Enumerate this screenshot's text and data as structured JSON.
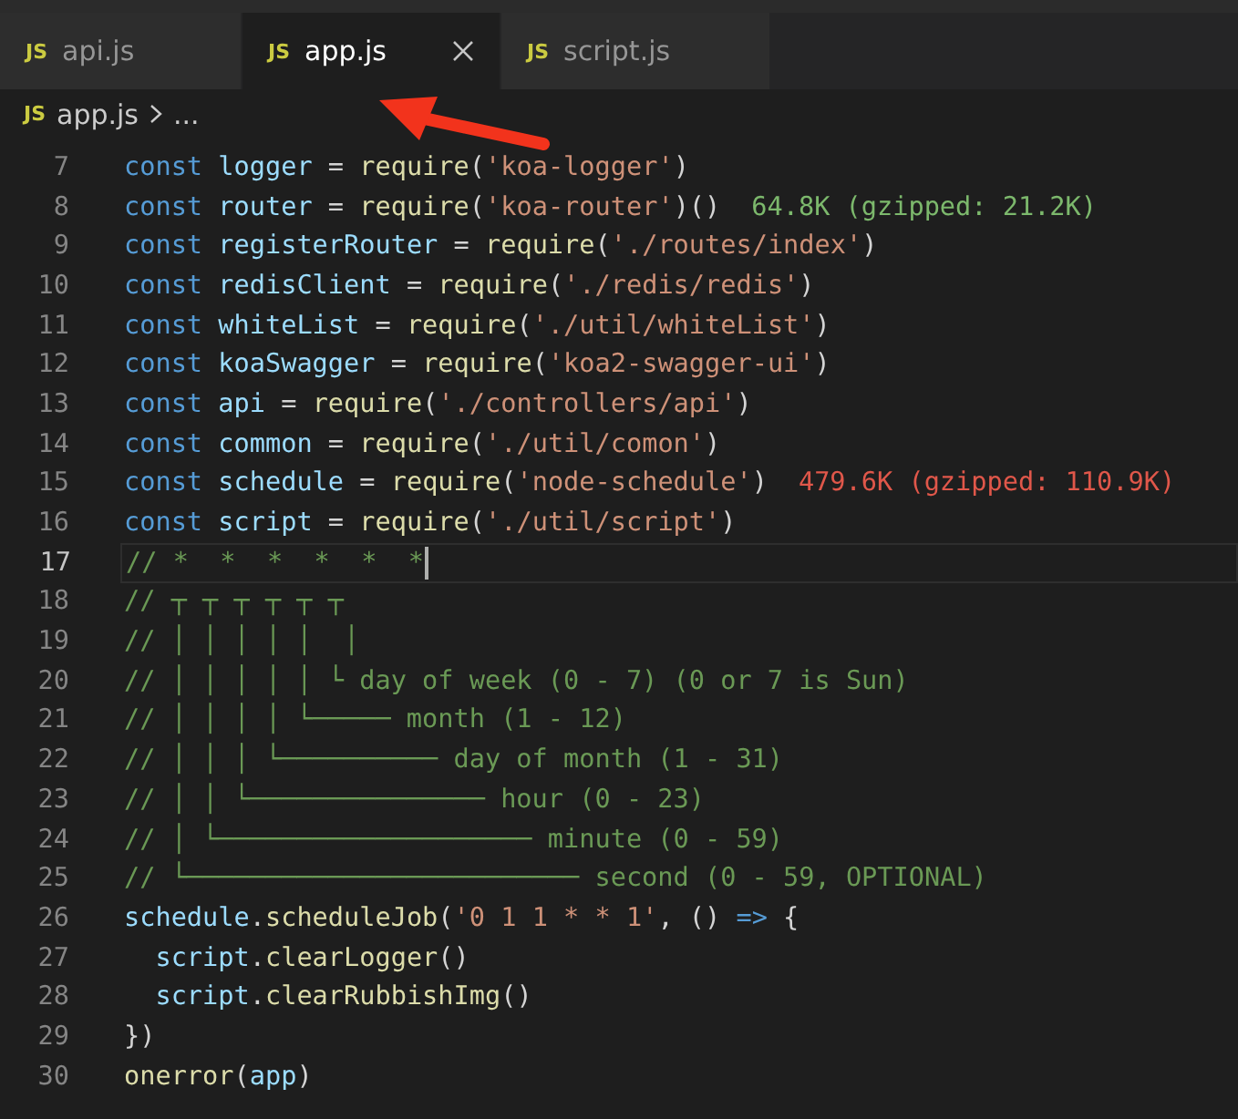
{
  "tabs": [
    {
      "badge": "JS",
      "label": "api.js",
      "selected": false
    },
    {
      "badge": "JS",
      "label": "app.js",
      "selected": true
    },
    {
      "badge": "JS",
      "label": "script.js",
      "selected": false
    }
  ],
  "breadcrumb": {
    "badge": "JS",
    "file": "app.js",
    "rest": "..."
  },
  "lines": [
    {
      "number": "7",
      "current": false,
      "tokens": [
        {
          "kind": "keyword",
          "text": "const "
        },
        {
          "kind": "variable",
          "text": "logger"
        },
        {
          "kind": "plain",
          "text": " = "
        },
        {
          "kind": "function",
          "text": "require"
        },
        {
          "kind": "plain",
          "text": "("
        },
        {
          "kind": "string",
          "text": "'koa-logger'"
        },
        {
          "kind": "plain",
          "text": ")"
        }
      ]
    },
    {
      "number": "8",
      "current": false,
      "tokens": [
        {
          "kind": "keyword",
          "text": "const "
        },
        {
          "kind": "variable",
          "text": "router"
        },
        {
          "kind": "plain",
          "text": " = "
        },
        {
          "kind": "function",
          "text": "require"
        },
        {
          "kind": "plain",
          "text": "("
        },
        {
          "kind": "string",
          "text": "'koa-router'"
        },
        {
          "kind": "plain",
          "text": ")()"
        }
      ],
      "hint": {
        "text": "64.8K (gzipped: 21.2K)",
        "color": "#7cb86c"
      }
    },
    {
      "number": "9",
      "current": false,
      "tokens": [
        {
          "kind": "keyword",
          "text": "const "
        },
        {
          "kind": "variable",
          "text": "registerRouter"
        },
        {
          "kind": "plain",
          "text": " = "
        },
        {
          "kind": "function",
          "text": "require"
        },
        {
          "kind": "plain",
          "text": "("
        },
        {
          "kind": "string",
          "text": "'./routes/index'"
        },
        {
          "kind": "plain",
          "text": ")"
        }
      ]
    },
    {
      "number": "10",
      "current": false,
      "tokens": [
        {
          "kind": "keyword",
          "text": "const "
        },
        {
          "kind": "variable",
          "text": "redisClient"
        },
        {
          "kind": "plain",
          "text": " = "
        },
        {
          "kind": "function",
          "text": "require"
        },
        {
          "kind": "plain",
          "text": "("
        },
        {
          "kind": "string",
          "text": "'./redis/redis'"
        },
        {
          "kind": "plain",
          "text": ")"
        }
      ]
    },
    {
      "number": "11",
      "current": false,
      "tokens": [
        {
          "kind": "keyword",
          "text": "const "
        },
        {
          "kind": "variable",
          "text": "whiteList"
        },
        {
          "kind": "plain",
          "text": " = "
        },
        {
          "kind": "function",
          "text": "require"
        },
        {
          "kind": "plain",
          "text": "("
        },
        {
          "kind": "string",
          "text": "'./util/whiteList'"
        },
        {
          "kind": "plain",
          "text": ")"
        }
      ]
    },
    {
      "number": "12",
      "current": false,
      "tokens": [
        {
          "kind": "keyword",
          "text": "const "
        },
        {
          "kind": "variable",
          "text": "koaSwagger"
        },
        {
          "kind": "plain",
          "text": " = "
        },
        {
          "kind": "function",
          "text": "require"
        },
        {
          "kind": "plain",
          "text": "("
        },
        {
          "kind": "string",
          "text": "'koa2-swagger-ui'"
        },
        {
          "kind": "plain",
          "text": ")"
        }
      ]
    },
    {
      "number": "13",
      "current": false,
      "tokens": [
        {
          "kind": "keyword",
          "text": "const "
        },
        {
          "kind": "variable",
          "text": "api"
        },
        {
          "kind": "plain",
          "text": " = "
        },
        {
          "kind": "function",
          "text": "require"
        },
        {
          "kind": "plain",
          "text": "("
        },
        {
          "kind": "string",
          "text": "'./controllers/api'"
        },
        {
          "kind": "plain",
          "text": ")"
        }
      ]
    },
    {
      "number": "14",
      "current": false,
      "tokens": [
        {
          "kind": "keyword",
          "text": "const "
        },
        {
          "kind": "variable",
          "text": "common"
        },
        {
          "kind": "plain",
          "text": " = "
        },
        {
          "kind": "function",
          "text": "require"
        },
        {
          "kind": "plain",
          "text": "("
        },
        {
          "kind": "string",
          "text": "'./util/comon'"
        },
        {
          "kind": "plain",
          "text": ")"
        }
      ]
    },
    {
      "number": "15",
      "current": false,
      "tokens": [
        {
          "kind": "keyword",
          "text": "const "
        },
        {
          "kind": "variable",
          "text": "schedule"
        },
        {
          "kind": "plain",
          "text": " = "
        },
        {
          "kind": "function",
          "text": "require"
        },
        {
          "kind": "plain",
          "text": "("
        },
        {
          "kind": "string",
          "text": "'node-schedule'"
        },
        {
          "kind": "plain",
          "text": ")"
        }
      ],
      "hint": {
        "text": "479.6K (gzipped: 110.9K)",
        "color": "#e0574a"
      }
    },
    {
      "number": "16",
      "current": false,
      "tokens": [
        {
          "kind": "keyword",
          "text": "const "
        },
        {
          "kind": "variable",
          "text": "script"
        },
        {
          "kind": "plain",
          "text": " = "
        },
        {
          "kind": "function",
          "text": "require"
        },
        {
          "kind": "plain",
          "text": "("
        },
        {
          "kind": "string",
          "text": "'./util/script'"
        },
        {
          "kind": "plain",
          "text": ")"
        }
      ]
    },
    {
      "number": "17",
      "current": true,
      "tokens": [
        {
          "kind": "comment",
          "text": "// *  *  *  *  *  *"
        }
      ]
    },
    {
      "number": "18",
      "current": false,
      "tokens": [
        {
          "kind": "comment",
          "text": "// ┬ ┬ ┬ ┬ ┬ ┬"
        }
      ]
    },
    {
      "number": "19",
      "current": false,
      "tokens": [
        {
          "kind": "comment",
          "text": "// │ │ │ │ │  │"
        }
      ]
    },
    {
      "number": "20",
      "current": false,
      "tokens": [
        {
          "kind": "comment",
          "text": "// │ │ │ │ │ └ day of week (0 - 7) (0 or 7 is Sun)"
        }
      ]
    },
    {
      "number": "21",
      "current": false,
      "tokens": [
        {
          "kind": "comment",
          "text": "// │ │ │ │ └───── month (1 - 12)"
        }
      ]
    },
    {
      "number": "22",
      "current": false,
      "tokens": [
        {
          "kind": "comment",
          "text": "// │ │ │ └────────── day of month (1 - 31)"
        }
      ]
    },
    {
      "number": "23",
      "current": false,
      "tokens": [
        {
          "kind": "comment",
          "text": "// │ │ └─────────────── hour (0 - 23)"
        }
      ]
    },
    {
      "number": "24",
      "current": false,
      "tokens": [
        {
          "kind": "comment",
          "text": "// │ └──────────────────── minute (0 - 59)"
        }
      ]
    },
    {
      "number": "25",
      "current": false,
      "tokens": [
        {
          "kind": "comment",
          "text": "// └───────────────────────── second (0 - 59, OPTIONAL)"
        }
      ]
    },
    {
      "number": "26",
      "current": false,
      "tokens": [
        {
          "kind": "variable",
          "text": "schedule"
        },
        {
          "kind": "plain",
          "text": "."
        },
        {
          "kind": "function",
          "text": "scheduleJob"
        },
        {
          "kind": "plain",
          "text": "("
        },
        {
          "kind": "string",
          "text": "'0 1 1 * * 1'"
        },
        {
          "kind": "plain",
          "text": ", () "
        },
        {
          "kind": "keyword",
          "text": "=>"
        },
        {
          "kind": "plain",
          "text": " {"
        }
      ]
    },
    {
      "number": "27",
      "current": false,
      "tokens": [
        {
          "kind": "variable",
          "text": "  script"
        },
        {
          "kind": "plain",
          "text": "."
        },
        {
          "kind": "function",
          "text": "clearLogger"
        },
        {
          "kind": "plain",
          "text": "()"
        }
      ]
    },
    {
      "number": "28",
      "current": false,
      "tokens": [
        {
          "kind": "variable",
          "text": "  script"
        },
        {
          "kind": "plain",
          "text": "."
        },
        {
          "kind": "function",
          "text": "clearRubbishImg"
        },
        {
          "kind": "plain",
          "text": "()"
        }
      ]
    },
    {
      "number": "29",
      "current": false,
      "tokens": [
        {
          "kind": "plain",
          "text": "})"
        }
      ]
    },
    {
      "number": "30",
      "current": false,
      "tokens": [
        {
          "kind": "function",
          "text": "onerror"
        },
        {
          "kind": "plain",
          "text": "("
        },
        {
          "kind": "variable",
          "text": "app"
        },
        {
          "kind": "plain",
          "text": ")"
        }
      ]
    }
  ]
}
